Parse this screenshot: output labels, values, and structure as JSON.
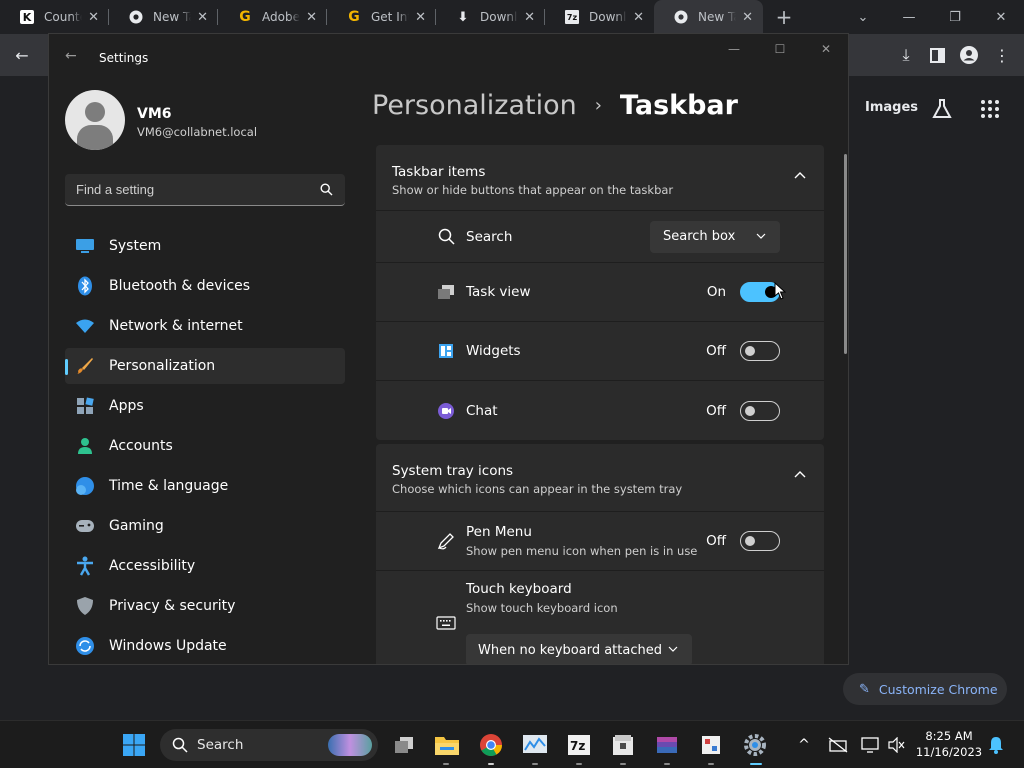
{
  "browser": {
    "tabs": [
      {
        "title": "Counter",
        "favicon": "k-icon",
        "active": false
      },
      {
        "title": "New Tab",
        "favicon": "chrome-icon",
        "active": false
      },
      {
        "title": "Adobe /",
        "favicon": "g-icon",
        "active": false
      },
      {
        "title": "Get Into",
        "favicon": "g-icon",
        "active": false
      },
      {
        "title": "Downlo",
        "favicon": "download-icon",
        "active": false
      },
      {
        "title": "Downlo",
        "favicon": "7zip-icon",
        "active": false
      },
      {
        "title": "New Tab",
        "favicon": "chrome-icon",
        "active": true
      }
    ],
    "images_link": "Images",
    "customize_label": "Customize Chrome"
  },
  "settings": {
    "window_title": "Settings",
    "user": {
      "name": "VM6",
      "email": "VM6@collabnet.local"
    },
    "search_placeholder": "Find a setting",
    "nav": [
      {
        "label": "System",
        "icon": "monitor-icon",
        "selected": false
      },
      {
        "label": "Bluetooth & devices",
        "icon": "bluetooth-icon",
        "selected": false
      },
      {
        "label": "Network & internet",
        "icon": "wifi-icon",
        "selected": false
      },
      {
        "label": "Personalization",
        "icon": "brush-icon",
        "selected": true
      },
      {
        "label": "Apps",
        "icon": "apps-icon",
        "selected": false
      },
      {
        "label": "Accounts",
        "icon": "person-icon",
        "selected": false
      },
      {
        "label": "Time & language",
        "icon": "globe-clock-icon",
        "selected": false
      },
      {
        "label": "Gaming",
        "icon": "gamepad-icon",
        "selected": false
      },
      {
        "label": "Accessibility",
        "icon": "accessibility-icon",
        "selected": false
      },
      {
        "label": "Privacy & security",
        "icon": "shield-icon",
        "selected": false
      },
      {
        "label": "Windows Update",
        "icon": "update-icon",
        "selected": false
      }
    ],
    "breadcrumb": {
      "parent": "Personalization",
      "separator": "›",
      "current": "Taskbar"
    },
    "taskbar_items": {
      "title": "Taskbar items",
      "subtitle": "Show or hide buttons that appear on the taskbar",
      "rows": [
        {
          "label": "Search",
          "icon": "search-icon",
          "control": "dropdown",
          "value": "Search box"
        },
        {
          "label": "Task view",
          "icon": "task-view-icon",
          "control": "toggle",
          "state": "On",
          "on": true
        },
        {
          "label": "Widgets",
          "icon": "widgets-icon",
          "control": "toggle",
          "state": "Off",
          "on": false
        },
        {
          "label": "Chat",
          "icon": "chat-icon",
          "control": "toggle",
          "state": "Off",
          "on": false
        }
      ]
    },
    "system_tray": {
      "title": "System tray icons",
      "subtitle": "Choose which icons can appear in the system tray",
      "pen": {
        "label": "Pen Menu",
        "sub": "Show pen menu icon when pen is in use",
        "state": "Off",
        "icon": "pen-icon"
      },
      "touch": {
        "label": "Touch keyboard",
        "sub": "Show touch keyboard icon",
        "value": "When no keyboard attached",
        "icon": "keyboard-icon"
      }
    }
  },
  "taskbar": {
    "search_label": "Search",
    "time": "8:25 AM",
    "date": "11/16/2023"
  },
  "colors": {
    "accent": "#4cc2ff",
    "selected_bar": "#60cdff",
    "link": "#8ab4f8"
  }
}
